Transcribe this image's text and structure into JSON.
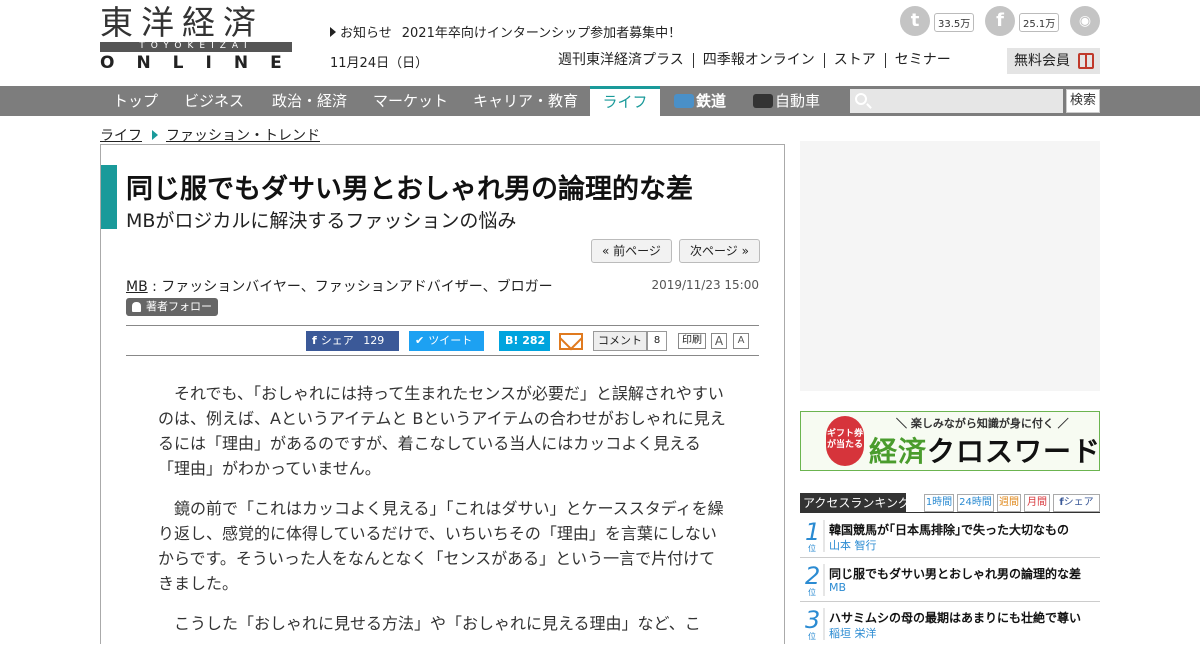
{
  "logo": {
    "kanji": "東洋経済",
    "romaji": "TOYOKEIZAI",
    "online": "ONLINE"
  },
  "header": {
    "notice_label": "お知らせ",
    "notice_text": "2021年卒向けインターンシップ参加者募集中！",
    "date": "11月24日（日）",
    "social": {
      "twitter_count": "33.5万",
      "facebook_count": "25.1万"
    },
    "top_links": [
      "週刊東洋経済プラス",
      "四季報オンライン",
      "ストア",
      "セミナー"
    ],
    "member_button": "無料会員"
  },
  "nav": {
    "items": [
      "トップ",
      "ビジネス",
      "政治・経済",
      "マーケット",
      "キャリア・教育",
      "ライフ",
      "鉄道",
      "自動車"
    ],
    "active": "ライフ",
    "search_placeholder": "",
    "search_button": "検索"
  },
  "breadcrumb": {
    "items": [
      "ライフ",
      "ファッション・トレンド"
    ]
  },
  "article": {
    "title": "同じ服でもダサい男とおしゃれ男の論理的な差",
    "subtitle": "MBがロジカルに解決するファッションの悩み",
    "prev_page": "« 前ページ",
    "next_page": "次ページ »",
    "author_name": "MB",
    "author_desc": " : ファッションバイヤー、ファッションアドバイザー、ブロガー",
    "published": "2019/11/23 15:00",
    "follow_label": "著者フォロー",
    "share": {
      "facebook_label": "シェア",
      "facebook_count": "129",
      "twitter_label": "ツイート",
      "hatena_count": "282",
      "comment_label": "コメント",
      "comment_count": "8",
      "print_label": "印刷",
      "font_large": "A",
      "font_small": "A"
    },
    "paragraphs": [
      "それでも、「おしゃれには持って生まれたセンスが必要だ」と誤解されやすいのは、例えば、Aというアイテムと Bというアイテムの合わせがおしゃれに見えるには「理由」があるのですが、着こなしている当人にはカッコよく見える「理由」がわかっていません。",
      "鏡の前で「これはカッコよく見える」「これはダサい」とケーススタディを繰り返し、感覚的に体得しているだけで、いちいちその「理由」を言葉にしないからです。そういった人をなんとなく「センスがある」という一言で片付けてきました。",
      "こうした「おしゃれに見せる方法」や「おしゃれに見える理由」など、こ"
    ]
  },
  "sidebar": {
    "banner": {
      "badge": "ギフト券が当たる",
      "tagline": "＼ 楽しみながら知識が身に付く ／",
      "title_a": "経済",
      "title_b": "クロスワード"
    },
    "ranking": {
      "title": "アクセスランキング",
      "tabs": [
        "1時間",
        "24時間",
        "週間",
        "月間",
        "シェア"
      ],
      "unit": "位",
      "items": [
        {
          "rank": "1",
          "title": "韓国競馬が｢日本馬排除｣で失った大切なもの",
          "author": "山本 智行"
        },
        {
          "rank": "2",
          "title": "同じ服でもダサい男とおしゃれ男の論理的な差",
          "author": "MB"
        },
        {
          "rank": "3",
          "title": "ハサミムシの母の最期はあまりにも壮絶で尊い",
          "author": "稲垣 栄洋"
        }
      ]
    }
  },
  "colors": {
    "accent": "#1a9a9a",
    "nav_bg": "#7d7d7d",
    "facebook": "#3b5998",
    "twitter": "#1da1f2",
    "hatena": "#00a4de",
    "ranking_blue": "#2b8bd2"
  }
}
